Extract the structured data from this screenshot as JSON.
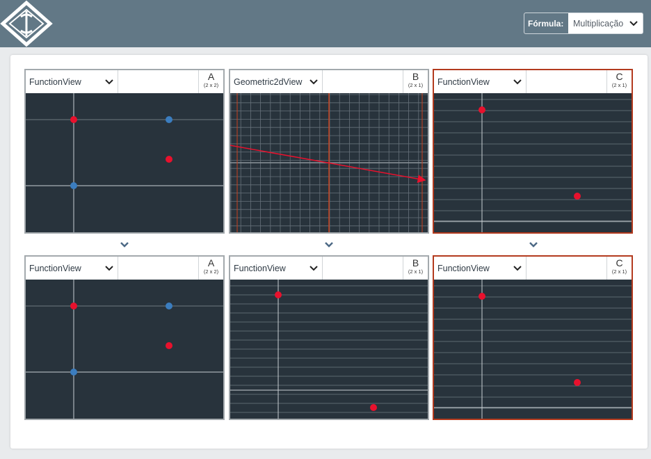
{
  "header": {
    "formula_label": "Fórmula:",
    "formula_value": "Multiplicação"
  },
  "panels_top": [
    {
      "view": "FunctionView",
      "letter": "A",
      "size": "(2 x 2)"
    },
    {
      "view": "Geometric2dView",
      "letter": "B",
      "size": "(2 x 1)"
    },
    {
      "view": "FunctionView",
      "letter": "C",
      "size": "(2 x 1)"
    }
  ],
  "panels_bottom": [
    {
      "view": "FunctionView",
      "letter": "A",
      "size": "(2 x 2)"
    },
    {
      "view": "FunctionView",
      "letter": "B",
      "size": "(2 x 1)"
    },
    {
      "view": "FunctionView",
      "letter": "C",
      "size": "(2 x 1)"
    }
  ],
  "colors": {
    "header_bg": "#627886",
    "canvas_bg": "#28333c",
    "selected_border": "#b33a1e",
    "point_red": "#e8112d",
    "point_blue": "#3b7dbf"
  },
  "icons": {
    "logo": "diamond-logo-icon",
    "dropdown": "chevron-down-icon",
    "expand": "chevron-down-icon"
  }
}
